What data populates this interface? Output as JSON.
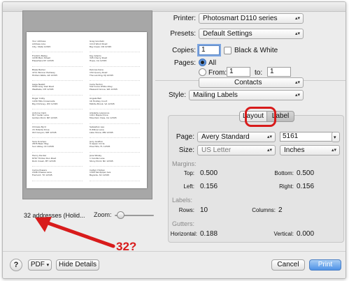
{
  "preview": {
    "caption": "32 addresses (Holid...",
    "zoom_label": "Zoom:",
    "labels": [
      [
        "Your Address",
        "Address Line",
        "City, State 12345"
      ],
      [
        "Greg Goodwin",
        "1110 Wood Road",
        "Big Creek, OR 12345"
      ],
      [
        "Franklin Bailey",
        "1038 Main Street",
        "Elsewhere NY 12345"
      ],
      [
        "Kay Adams",
        "345 Cherry Road",
        "Hope, CA 12345"
      ],
      [
        "Blake Barker",
        "4711 Bonner Parkway",
        "Hidden Wells, AZ 12345"
      ],
      [
        "Delores Kane",
        "150 Quarry Road",
        "The Landing, NJ 12345"
      ],
      [
        "Gage Nesbit",
        "5500 Gray Oak Road",
        "Westlake, OH 12345"
      ],
      [
        "Carla Fenton",
        "542 Snow White Alley",
        "Pleasant Grove, WA 12345"
      ],
      [
        "Roger Colby",
        "1430 Hills Crossroads",
        "Big Chimney, WV 12345"
      ],
      [
        "Angela Bell",
        "16 Holiday Court",
        "Middle Brook, VA 12345"
      ],
      [
        "Antoine Clark",
        "817 Cedar Lane",
        "Golden Pond, NH 12345"
      ],
      [
        "Adelaide Lawrence",
        "1411 Maple Drive",
        "Mountain View, CA 12345"
      ],
      [
        "Chrissie Byrd",
        "15 Hillside Drive",
        "Old Canyon, NM 12345"
      ],
      [
        "Sebastian Lee",
        "8 Willow Lane",
        "Lake Shore, MN 12345"
      ],
      [
        "Sara Ocampo",
        "2876 Bean Way",
        "Sun Valley, ID 12345"
      ],
      [
        "Jerry Grafton",
        "9 Aspen Circle",
        "Pine Hills, FL 12345"
      ],
      [
        "Henry Decker",
        "8767 Timber Run Road",
        "Rock Creek, MT 12345"
      ],
      [
        "Jane Wisley",
        "1 Candle Lane",
        "Stony Point, NC 12345"
      ],
      [
        "Carlos Powers",
        "2446 Cheese Lane",
        "Fremont, TX 12345"
      ],
      [
        "Caitlyn Holden",
        "1300 Sandpiper Ave",
        "Bayside, SC 12345"
      ]
    ]
  },
  "annotation": {
    "text": "32?"
  },
  "printer": {
    "label": "Printer:",
    "value": "Photosmart D110 series"
  },
  "presets": {
    "label": "Presets:",
    "value": "Default Settings"
  },
  "copies": {
    "label": "Copies:",
    "value": "1",
    "bw_label": "Black & White"
  },
  "pages": {
    "label": "Pages:",
    "all_label": "All",
    "from_label": "From:",
    "from_value": "1",
    "to_label": "to:",
    "to_value": "1"
  },
  "app_menu": {
    "value": "Contacts"
  },
  "style": {
    "label": "Style:",
    "value": "Mailing Labels"
  },
  "tabs": {
    "layout": "Layout",
    "label": "Label"
  },
  "page_row": {
    "label": "Page:",
    "value": "Avery Standard",
    "code": "5161"
  },
  "size_row": {
    "label": "Size:",
    "value": "US Letter",
    "units": "Inches"
  },
  "margins": {
    "heading": "Margins:",
    "top_label": "Top:",
    "top": "0.500",
    "bottom_label": "Bottom:",
    "bottom": "0.500",
    "left_label": "Left:",
    "left": "0.156",
    "right_label": "Right:",
    "right": "0.156"
  },
  "labels_section": {
    "heading": "Labels:",
    "rows_label": "Rows:",
    "rows": "10",
    "columns_label": "Columns:",
    "columns": "2"
  },
  "gutters": {
    "heading": "Gutters:",
    "horizontal_label": "Horizontal:",
    "horizontal": "0.188",
    "vertical_label": "Vertical:",
    "vertical": "0.000"
  },
  "footer": {
    "help": "?",
    "pdf": "PDF",
    "hide_details": "Hide Details",
    "cancel": "Cancel",
    "print": "Print"
  },
  "colors": {
    "annotation": "#d81b1b",
    "accent": "#4d92e6"
  }
}
